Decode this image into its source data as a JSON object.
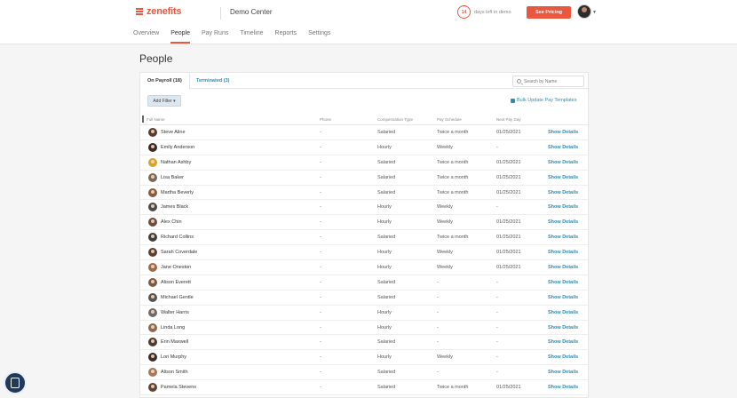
{
  "header": {
    "logo": "zenefits",
    "company": "Demo Center",
    "trial_days": "14",
    "trial_text": "days left in demo",
    "pricing_label": "See Pricing"
  },
  "nav": [
    {
      "label": "Overview",
      "active": false
    },
    {
      "label": "People",
      "active": true
    },
    {
      "label": "Pay Runs",
      "active": false
    },
    {
      "label": "Timeline",
      "active": false
    },
    {
      "label": "Reports",
      "active": false
    },
    {
      "label": "Settings",
      "active": false
    }
  ],
  "page": {
    "title": "People"
  },
  "tabs": {
    "on_payroll": "On Payroll (18)",
    "terminated": "Terminated (3)"
  },
  "search": {
    "placeholder": "Search by Name"
  },
  "toolbar": {
    "add_filter": "Add Filter ▾",
    "bulk_update": "Bulk Update Pay Templates"
  },
  "table": {
    "columns": [
      "Full Name",
      "Phone",
      "Compensation Type",
      "Pay Schedule",
      "Next Pay Day"
    ],
    "action_label": "Show Details",
    "rows": [
      {
        "name": "Steve Aline",
        "phone": "-",
        "comp": "Salaried",
        "schedule": "Twice a month",
        "next": "01/25/2021",
        "color": "#5a3b2e"
      },
      {
        "name": "Emily Anderson",
        "phone": "-",
        "comp": "Hourly",
        "schedule": "Weekly",
        "next": "-",
        "color": "#3b2a22"
      },
      {
        "name": "Nathan Ashby",
        "phone": "-",
        "comp": "Salaried",
        "schedule": "Twice a month",
        "next": "01/25/2021",
        "color": "#d6a22b"
      },
      {
        "name": "Lisa Baker",
        "phone": "-",
        "comp": "Salaried",
        "schedule": "Twice a month",
        "next": "01/25/2021",
        "color": "#7a6a58"
      },
      {
        "name": "Martha Beverly",
        "phone": "-",
        "comp": "Salaried",
        "schedule": "Twice a month",
        "next": "01/25/2021",
        "color": "#8b5a3c"
      },
      {
        "name": "James Black",
        "phone": "-",
        "comp": "Hourly",
        "schedule": "Weekly",
        "next": "-",
        "color": "#4a4a4a"
      },
      {
        "name": "Alex Chin",
        "phone": "-",
        "comp": "Hourly",
        "schedule": "Weekly",
        "next": "01/25/2021",
        "color": "#6b4e3d"
      },
      {
        "name": "Richard Collins",
        "phone": "-",
        "comp": "Salaried",
        "schedule": "Twice a month",
        "next": "01/25/2021",
        "color": "#3e3e3e"
      },
      {
        "name": "Sarah Coverdale",
        "phone": "-",
        "comp": "Hourly",
        "schedule": "Weekly",
        "next": "01/25/2021",
        "color": "#5c4033"
      },
      {
        "name": "Jane Oneston",
        "phone": "-",
        "comp": "Hourly",
        "schedule": "Weekly",
        "next": "01/25/2021",
        "color": "#9b6b4a"
      },
      {
        "name": "Alison Everett",
        "phone": "-",
        "comp": "Salaried",
        "schedule": "-",
        "next": "-",
        "color": "#7c5b46"
      },
      {
        "name": "Michael Gentle",
        "phone": "-",
        "comp": "Salaried",
        "schedule": "-",
        "next": "-",
        "color": "#555555"
      },
      {
        "name": "Walter Harris",
        "phone": "-",
        "comp": "Hourly",
        "schedule": "-",
        "next": "-",
        "color": "#6d6d6d"
      },
      {
        "name": "Linda Long",
        "phone": "-",
        "comp": "Hourly",
        "schedule": "-",
        "next": "-",
        "color": "#8a6a50"
      },
      {
        "name": "Erin Maxwell",
        "phone": "-",
        "comp": "Salaried",
        "schedule": "-",
        "next": "-",
        "color": "#4d3a30"
      },
      {
        "name": "Lori Murphy",
        "phone": "-",
        "comp": "Hourly",
        "schedule": "Weekly",
        "next": "-",
        "color": "#3a2d27"
      },
      {
        "name": "Alison Smith",
        "phone": "-",
        "comp": "Salaried",
        "schedule": "-",
        "next": "-",
        "color": "#a07a5a"
      },
      {
        "name": "Pamela Stevens",
        "phone": "-",
        "comp": "Salaried",
        "schedule": "Twice a month",
        "next": "01/25/2021",
        "color": "#5e4536"
      }
    ]
  }
}
